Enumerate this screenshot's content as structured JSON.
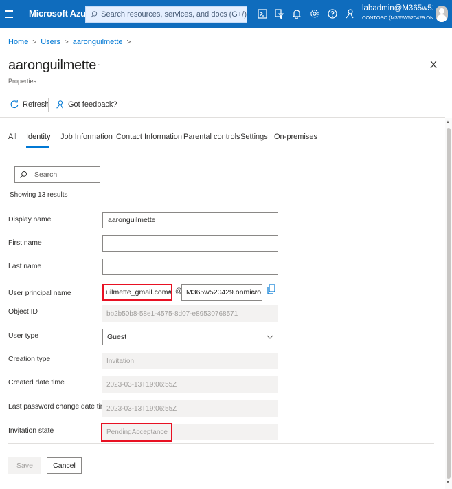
{
  "topbar": {
    "brand": "Microsoft Azure",
    "search_placeholder": "Search resources, services, and docs (G+/)",
    "account_name": "labadmin@M365w5204...",
    "account_tenant": "CONTOSO (M365W520429.ONM...",
    "accent_color": "#0f6cbd"
  },
  "breadcrumb": {
    "items": [
      "Home",
      "Users",
      "aaronguilmette"
    ],
    "separator": ">"
  },
  "page": {
    "title": "aaronguilmette",
    "more": "···",
    "subtitle": "Properties",
    "close": "X"
  },
  "commands": {
    "refresh": "Refresh",
    "feedback": "Got feedback?"
  },
  "tabs": [
    {
      "label": "All"
    },
    {
      "label": "Identity",
      "active": true
    },
    {
      "label": "Job Information"
    },
    {
      "label": "Contact Information"
    },
    {
      "label": "Parental controls"
    },
    {
      "label": "Settings"
    },
    {
      "label": "On-premises"
    }
  ],
  "filter": {
    "placeholder": "Search",
    "results": "Showing 13 results"
  },
  "form": {
    "display_name": {
      "label": "Display name",
      "value": "aaronguilmette"
    },
    "first_name": {
      "label": "First name",
      "value": ""
    },
    "last_name": {
      "label": "Last name",
      "value": ""
    },
    "upn": {
      "label": "User principal name",
      "value": "uilmette_gmail.com#EXT#",
      "at": "@",
      "domain": "M365w520429.onmicro..."
    },
    "object_id": {
      "label": "Object ID",
      "value": "bb2b50b8-58e1-4575-8d07-e89530768571"
    },
    "user_type": {
      "label": "User type",
      "value": "Guest"
    },
    "creation_type": {
      "label": "Creation type",
      "value": "Invitation"
    },
    "created": {
      "label": "Created date time",
      "value": "2023-03-13T19:06:55Z"
    },
    "last_pw": {
      "label": "Last password change date time",
      "value": "2023-03-13T19:06:55Z"
    },
    "invitation_state": {
      "label": "Invitation state",
      "value": "PendingAcceptance"
    }
  },
  "buttons": {
    "save": "Save",
    "cancel": "Cancel"
  },
  "highlight_color": "#e81123"
}
